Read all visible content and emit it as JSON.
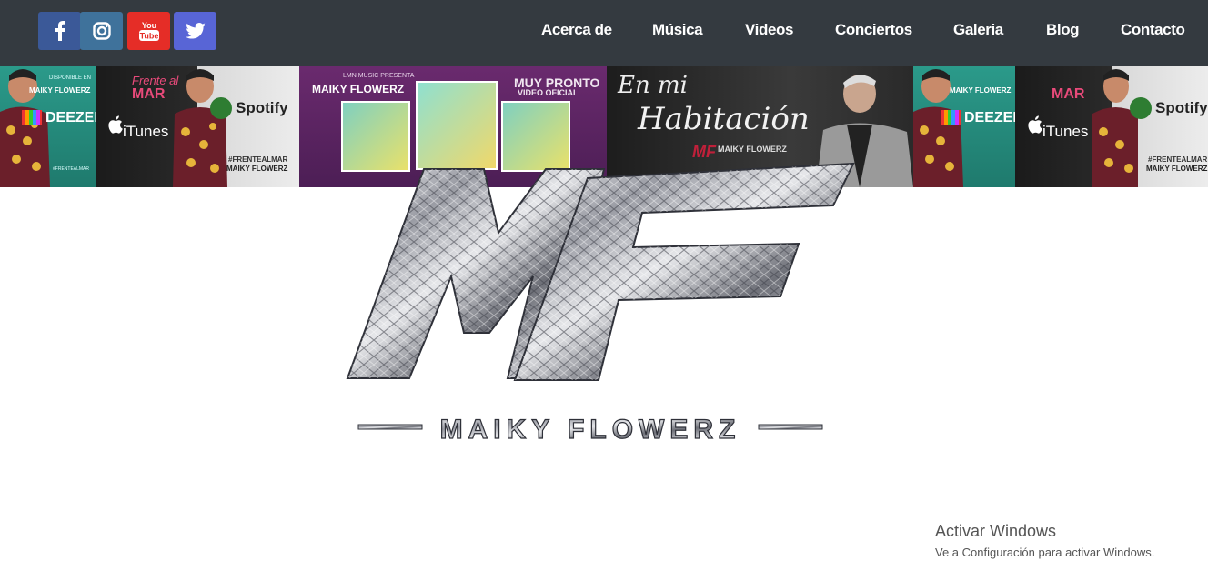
{
  "social": {
    "facebook": {
      "label": "f",
      "color": "#3b5998"
    },
    "instagram": {
      "label": "instagram",
      "color": "#3f729b"
    },
    "youtube": {
      "label": "You Tube",
      "color": "#e52d27"
    },
    "twitter": {
      "label": "twitter",
      "color": "#5865d6"
    }
  },
  "nav": {
    "items": [
      "Acerca de",
      "Música",
      "Videos",
      "Conciertos",
      "Galeria",
      "Blog",
      "Contacto"
    ]
  },
  "banner": {
    "panel1": {
      "tag": "DISPONIBLE EN",
      "artist": "MAIKY FLOWERZ",
      "service": "DEEZER",
      "hashtag": "#FRENTEALMAR"
    },
    "panel2": {
      "title_script": "Frente al",
      "title": "MAR",
      "service": "iTunes",
      "service2": "Spotify",
      "hashtag": "#FRENTEALMAR",
      "artist": "MAIKY FLOWERZ"
    },
    "panel3": {
      "presenter": "LMN MUSIC PRESENTA",
      "artist": "MAIKY FLOWERZ",
      "soon": "MUY PRONTO",
      "soon2": "VIDEO OFICIAL"
    },
    "panel4": {
      "script1": "En mi",
      "script2": "Habitación",
      "mark": "MF",
      "artist": "MAIKY FLOWERZ"
    },
    "panel5": {
      "artist": "MAIKY FLOWERZ",
      "service": "DEEZER"
    },
    "panel6": {
      "title": "MAR",
      "service": "iTunes",
      "service2": "Spotify",
      "hashtag": "#FRENTEALMAR",
      "artist": "MAIKY FLOWERZ"
    }
  },
  "logo": {
    "monogram": "MF",
    "name": "MAIKY   FLOWERZ"
  },
  "windows_watermark": {
    "title": "Activar Windows",
    "subtitle": "Ve a Configuración para activar Windows."
  }
}
